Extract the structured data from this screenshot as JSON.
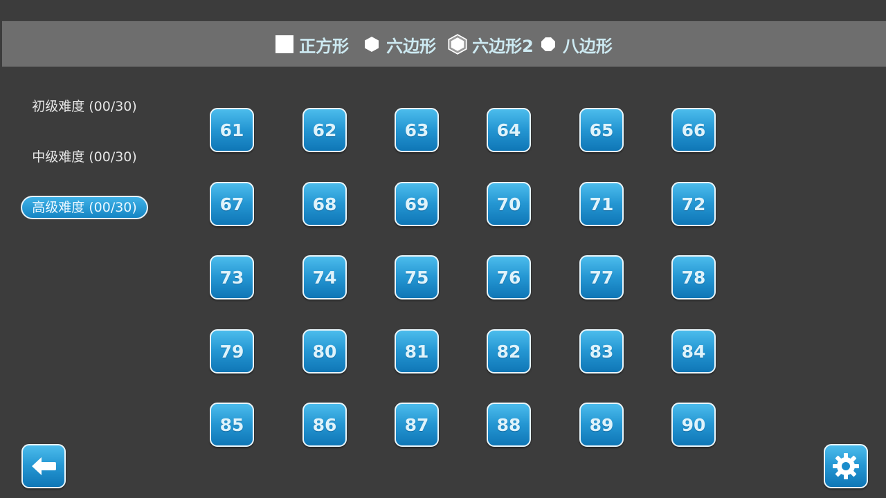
{
  "shape_tabs": [
    {
      "label": "正方形",
      "icon": "square-icon"
    },
    {
      "label": "六边形",
      "icon": "hexagon-icon"
    },
    {
      "label": "六边形2",
      "icon": "hexagon-outline-icon"
    },
    {
      "label": "八边形",
      "icon": "octagon-icon"
    }
  ],
  "selected_shape": "六边形2",
  "difficulties": [
    {
      "label": "初级难度 (00/30)",
      "selected": false
    },
    {
      "label": "中级难度 (00/30)",
      "selected": false
    },
    {
      "label": "高级难度 (00/30)",
      "selected": true
    }
  ],
  "levels": [
    "61",
    "62",
    "63",
    "64",
    "65",
    "66",
    "67",
    "68",
    "69",
    "70",
    "71",
    "72",
    "73",
    "74",
    "75",
    "76",
    "77",
    "78",
    "79",
    "80",
    "81",
    "82",
    "83",
    "84",
    "85",
    "86",
    "87",
    "88",
    "89",
    "90"
  ],
  "colors": {
    "background": "#3c3c3c",
    "topbar": "#6e6e6e",
    "button_blue": "#2597d3",
    "tab_text": "#cdeaf2"
  },
  "corner_buttons": {
    "back_icon": "back-arrow-icon",
    "settings_icon": "gear-icon"
  }
}
